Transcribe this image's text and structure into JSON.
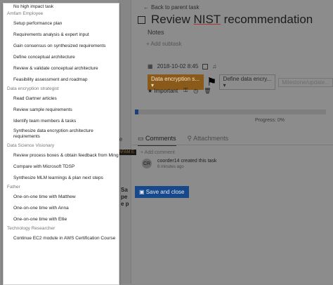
{
  "detail": {
    "back_link": "Back to parent task",
    "task_title_prefix": "Review ",
    "task_title_underlined": "NIST",
    "task_title_suffix": " recommendation",
    "notes_label": "Notes",
    "add_subtask": "+ Add subtask",
    "due_date": "2018-10-02 8:45",
    "tag1": "Data encryption s...",
    "tag2": "Define data encry...",
    "tag3": "Milestone/update...",
    "important_label": "Important",
    "progress_label": "Progress: 0%",
    "progress_value": 0.02,
    "tab_comments": "Comments",
    "tab_attachments": "Attachments",
    "add_comment": "+ Add comment",
    "avatar_initials": "CR",
    "activity_text": "coorder14 created this task",
    "activity_time": "6 minutes ago",
    "save_button": "Save and close"
  },
  "underlay": {
    "left_label": "le",
    "tag_label": "AFAM E",
    "text_line1": "Sa",
    "text_line2": "pe",
    "text_line3": "e p"
  },
  "dropdown": {
    "entries": [
      {
        "kind": "item",
        "label": "No high impact task",
        "size": "short"
      },
      {
        "kind": "group",
        "label": "Amfam Employee"
      },
      {
        "kind": "item",
        "label": "Setup performance plan"
      },
      {
        "kind": "item",
        "label": "Requirements analysis & expert input"
      },
      {
        "kind": "item",
        "label": "Gain consensus on synthesized requirements"
      },
      {
        "kind": "item",
        "label": "Define conceptual architecture"
      },
      {
        "kind": "item",
        "label": "Review & validate conceptual architecture"
      },
      {
        "kind": "item",
        "label": "Feasibility assessment and roadmap"
      },
      {
        "kind": "group",
        "label": "Data encryption strategist"
      },
      {
        "kind": "item",
        "label": "Read Gartner articles"
      },
      {
        "kind": "item",
        "label": "Review sample requirements"
      },
      {
        "kind": "item",
        "label": "Identify team members & tasks"
      },
      {
        "kind": "item",
        "label": "Synthesize data encryption architecture requirements",
        "size": "tall"
      },
      {
        "kind": "group",
        "label": "Data Science Visionary"
      },
      {
        "kind": "item",
        "label": "Review process boxes & obtain feedback from Ming"
      },
      {
        "kind": "item",
        "label": "Compare with Microsoft TDSP"
      },
      {
        "kind": "item",
        "label": "Synthesize MLM learnings & plan next steps"
      },
      {
        "kind": "group",
        "label": "Father"
      },
      {
        "kind": "item",
        "label": "One-on-one time with Matthew"
      },
      {
        "kind": "item",
        "label": "One-on-one time with Anna"
      },
      {
        "kind": "item",
        "label": "One-on-one time with Ellie"
      },
      {
        "kind": "group",
        "label": "Technology Researcher"
      },
      {
        "kind": "item",
        "label": "Continue EC2 module in AWS Certification Course"
      }
    ]
  }
}
